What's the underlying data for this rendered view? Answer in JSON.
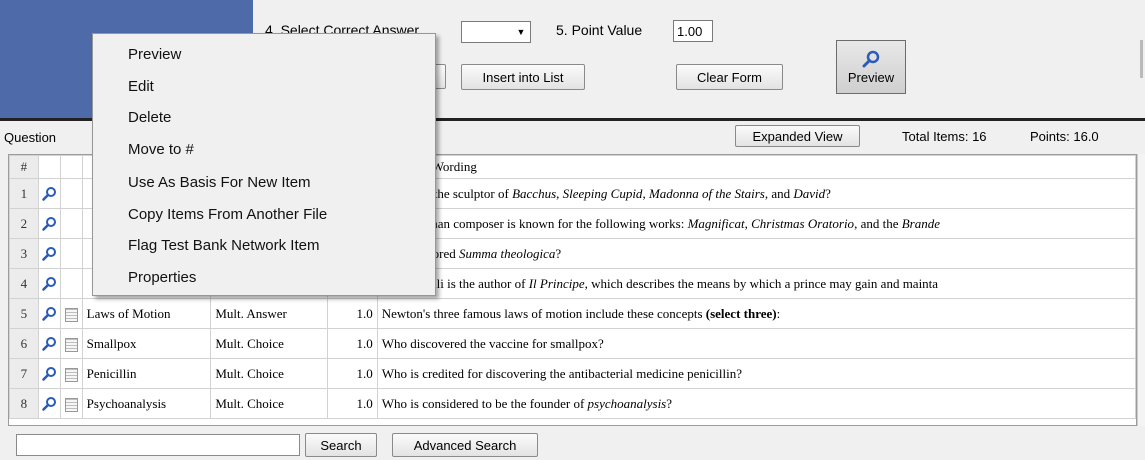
{
  "form": {
    "select_answer_label": "4. Select Correct Answer",
    "select_answer_value": "",
    "point_value_label": "5. Point Value",
    "point_value": "1.00",
    "insert_button": "Insert into List",
    "clear_button": "Clear Form",
    "preview_button": "Preview"
  },
  "questions_bar": {
    "label": "Question",
    "expanded_view_button": "Expanded View",
    "total_items": "Total Items: 16",
    "points": "Points: 16.0"
  },
  "table": {
    "num_header": "#",
    "wording_header": "Question Wording",
    "rows": [
      {
        "num": "1",
        "title": "",
        "type": "",
        "points": "",
        "wording_html": "Who was the sculptor of <i>Bacchus</i>, <i>Sleeping Cupid</i>, <i>Madonna of the Stairs</i>, and <i>David</i>?"
      },
      {
        "num": "2",
        "title": "",
        "type": "",
        "points": "",
        "wording_html": "This German composer is known for the following works: <i>Magnificat</i>, <i>Christmas Oratorio</i>, and the <i>Brande</i>"
      },
      {
        "num": "3",
        "title": "",
        "type": "",
        "points": "",
        "wording_html": "Who authored <i>Summa theologica</i>?"
      },
      {
        "num": "4",
        "title": "",
        "type": "",
        "points": "",
        "wording_html": "Machiavelli is the author of <i>Il Principe</i>, which describes the means by which a prince may gain and mainta"
      },
      {
        "num": "5",
        "title": "Laws of Motion",
        "type": "Mult. Answer",
        "points": "1.0",
        "wording_html": "Newton's three famous laws of motion include these concepts <b>(select three)</b>:"
      },
      {
        "num": "6",
        "title": "Smallpox",
        "type": "Mult. Choice",
        "points": "1.0",
        "wording_html": "Who discovered the vaccine for smallpox?"
      },
      {
        "num": "7",
        "title": "Penicillin",
        "type": "Mult. Choice",
        "points": "1.0",
        "wording_html": "Who is credited for discovering the antibacterial medicine penicillin?"
      },
      {
        "num": "8",
        "title": "Psychoanalysis",
        "type": "Mult. Choice",
        "points": "1.0",
        "wording_html": "Who is considered to be the founder of <i>psychoanalysis</i>?"
      }
    ]
  },
  "search": {
    "value": "",
    "search_button": "Search",
    "advanced_button": "Advanced Search"
  },
  "context_menu": {
    "items": [
      "Preview",
      "Edit",
      "Delete",
      "Move to #",
      "Use As Basis For New Item",
      "Copy Items From Another File",
      "Flag Test Bank Network Item",
      "Properties"
    ]
  },
  "colors": {
    "blue_panel": "#4e6aa8",
    "icon_blue": "#2a5bb8"
  }
}
